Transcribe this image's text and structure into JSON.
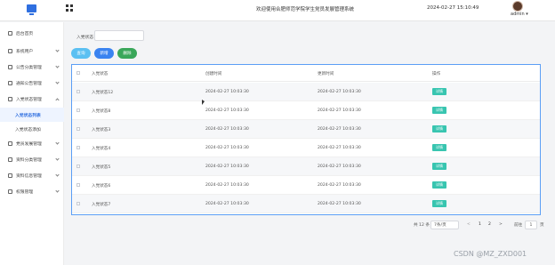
{
  "header": {
    "title": "欢迎使用合肥师范学院学生党员发展管理系统",
    "datetime": "2024-02-27 15:10:49",
    "user": "admin ▾"
  },
  "sidebar": {
    "items": [
      {
        "label": "后台首页"
      },
      {
        "label": "系统用户"
      },
      {
        "label": "公告分类管理"
      },
      {
        "label": "通知公告管理"
      },
      {
        "label": "入党状态管理"
      },
      {
        "label": "党员发展管理"
      },
      {
        "label": "资料分类管理"
      },
      {
        "label": "资料信息管理"
      },
      {
        "label": "权限管理"
      }
    ],
    "sub_items": [
      {
        "label": "入党状态列表"
      },
      {
        "label": "入党状态添加"
      }
    ]
  },
  "filter": {
    "label": "入党状态",
    "value": "",
    "placeholder": ""
  },
  "toolbar": {
    "search_label": "查询",
    "add_label": "新增",
    "delete_label": "删除"
  },
  "table": {
    "columns": [
      "入党状态",
      "创建时间",
      "更新时间",
      "操作"
    ],
    "rows": [
      {
        "status": "入党状态12",
        "created": "2024-02-27 10:03:30",
        "updated": "2024-02-27 10:03:30",
        "action": "详情"
      },
      {
        "status": "入党状态8",
        "created": "2024-02-27 10:03:30",
        "updated": "2024-02-27 10:03:30",
        "action": "详情"
      },
      {
        "status": "入党状态3",
        "created": "2024-02-27 10:03:30",
        "updated": "2024-02-27 10:03:30",
        "action": "详情"
      },
      {
        "status": "入党状态4",
        "created": "2024-02-27 10:03:30",
        "updated": "2024-02-27 10:03:30",
        "action": "详情"
      },
      {
        "status": "入党状态5",
        "created": "2024-02-27 10:03:30",
        "updated": "2024-02-27 10:03:30",
        "action": "详情"
      },
      {
        "status": "入党状态6",
        "created": "2024-02-27 10:03:30",
        "updated": "2024-02-27 10:03:30",
        "action": "详情"
      },
      {
        "status": "入党状态7",
        "created": "2024-02-27 10:03:30",
        "updated": "2024-02-27 10:03:30",
        "action": "详情"
      }
    ]
  },
  "pagination": {
    "total": "共 12 条",
    "page_size": "7条/页",
    "prev": "<",
    "pages": [
      "1",
      "2"
    ],
    "next": ">",
    "goto_label": "前往",
    "goto_value": "1",
    "goto_suffix": "页"
  },
  "watermark": "CSDN @MZ_ZXD001",
  "colors": {
    "accent": "#2f6fe0",
    "search": "#5bc0f2",
    "add": "#3a83f0",
    "delete": "#3aa75a",
    "detail": "#38c5b0",
    "table_border": "#5b9ef5"
  },
  "icons": {
    "logo": "monitor-icon",
    "menu_toggle": "grid-icon"
  }
}
